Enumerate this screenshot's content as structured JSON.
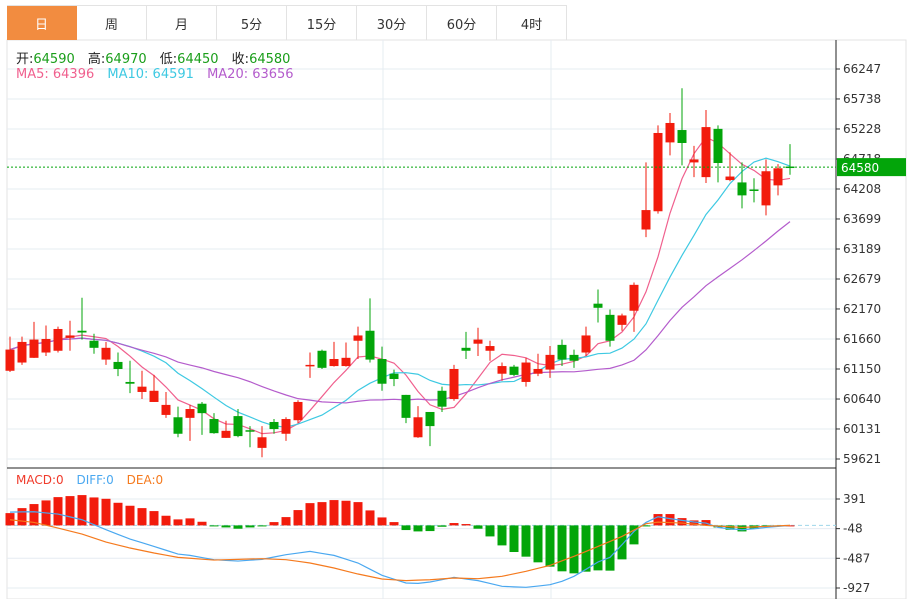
{
  "tabs": [
    {
      "label": "日",
      "active": true
    },
    {
      "label": "周"
    },
    {
      "label": "月"
    },
    {
      "label": "5分"
    },
    {
      "label": "15分"
    },
    {
      "label": "30分"
    },
    {
      "label": "60分"
    },
    {
      "label": "4时"
    }
  ],
  "ohlc_info": {
    "open_label": "开:",
    "open": "64590",
    "high_label": "高:",
    "high": "64970",
    "low_label": "低:",
    "low": "64450",
    "close_label": "收:",
    "close": "64580"
  },
  "ma_info": {
    "ma5": "MA5: 64396",
    "ma10": "MA10: 64591",
    "ma20": "MA20: 63656"
  },
  "macd_info": {
    "macd": "MACD:0",
    "diff": "DIFF:0",
    "dea": "DEA:0"
  },
  "current_price": "64580",
  "colors": {
    "up": "#f21b0c",
    "down": "#03a50a",
    "ma5": "#f0608e",
    "ma10": "#3ec9e2",
    "ma20": "#b45ccc",
    "diff": "#4aa8f0",
    "dea": "#f57a1e",
    "tab_active": "#f28c40"
  },
  "chart_data": {
    "type": "candlestick",
    "price_ticks": [
      66247,
      65738,
      65228,
      64718,
      64208,
      63699,
      63189,
      62679,
      62170,
      61660,
      61150,
      60640,
      60131,
      59621
    ],
    "macd_ticks": [
      391,
      -48,
      -487,
      -927
    ],
    "ohlc": [
      [
        61120,
        61700,
        61100,
        61480
      ],
      [
        61260,
        61700,
        61220,
        61610
      ],
      [
        61340,
        61950,
        61340,
        61650
      ],
      [
        61430,
        61890,
        61370,
        61660
      ],
      [
        61460,
        61870,
        61430,
        61830
      ],
      [
        61680,
        61970,
        61460,
        61720
      ],
      [
        61800,
        62360,
        61650,
        61770
      ],
      [
        61630,
        61750,
        61410,
        61510
      ],
      [
        61310,
        61610,
        61220,
        61510
      ],
      [
        61270,
        61430,
        61030,
        61150
      ],
      [
        60930,
        61290,
        60740,
        60900
      ],
      [
        60760,
        61120,
        60640,
        60850
      ],
      [
        60590,
        61050,
        60590,
        60780
      ],
      [
        60370,
        60760,
        60320,
        60540
      ],
      [
        60330,
        60510,
        59990,
        60050
      ],
      [
        60320,
        60540,
        59930,
        60470
      ],
      [
        60560,
        60590,
        60030,
        60400
      ],
      [
        60300,
        60400,
        60050,
        60060
      ],
      [
        59980,
        60270,
        59980,
        60100
      ],
      [
        60350,
        60470,
        59990,
        60010
      ],
      [
        60110,
        60180,
        59820,
        60100
      ],
      [
        59810,
        60180,
        59650,
        59990
      ],
      [
        60250,
        60300,
        60050,
        60130
      ],
      [
        60050,
        60330,
        59930,
        60300
      ],
      [
        60280,
        60620,
        60230,
        60590
      ],
      [
        61200,
        61430,
        61000,
        61220
      ],
      [
        61460,
        61480,
        61150,
        61170
      ],
      [
        61200,
        61610,
        61190,
        61320
      ],
      [
        61200,
        61600,
        61190,
        61340
      ],
      [
        61630,
        61870,
        61320,
        61720
      ],
      [
        61800,
        62350,
        61260,
        61310
      ],
      [
        61320,
        61530,
        60780,
        60900
      ],
      [
        61070,
        61140,
        60860,
        60980
      ],
      [
        60710,
        60710,
        60230,
        60320
      ],
      [
        59990,
        60520,
        59980,
        60330
      ],
      [
        60420,
        60420,
        59840,
        60180
      ],
      [
        60780,
        60850,
        60420,
        60510
      ],
      [
        60640,
        61220,
        60610,
        61150
      ],
      [
        61510,
        61780,
        61320,
        61460
      ],
      [
        61580,
        61850,
        61370,
        61650
      ],
      [
        61460,
        61630,
        61290,
        61540
      ],
      [
        61070,
        61260,
        60950,
        61200
      ],
      [
        61190,
        61220,
        61030,
        61050
      ],
      [
        60930,
        61340,
        60850,
        61260
      ],
      [
        61070,
        61410,
        61030,
        61150
      ],
      [
        61140,
        61540,
        61000,
        61390
      ],
      [
        61560,
        61650,
        61200,
        61310
      ],
      [
        61390,
        61480,
        61170,
        61290
      ],
      [
        61430,
        61870,
        61370,
        61720
      ],
      [
        62260,
        62500,
        61940,
        62190
      ],
      [
        62070,
        62160,
        61530,
        61630
      ],
      [
        61900,
        62090,
        61800,
        62060
      ],
      [
        62140,
        62620,
        61780,
        62580
      ],
      [
        63520,
        64660,
        63390,
        63850
      ],
      [
        63830,
        65290,
        63790,
        65160
      ],
      [
        65000,
        65500,
        64780,
        65330
      ],
      [
        65210,
        65920,
        64610,
        64990
      ],
      [
        64660,
        64940,
        64410,
        64710
      ],
      [
        64410,
        65550,
        64310,
        65260
      ],
      [
        65230,
        65290,
        64320,
        64650
      ],
      [
        64360,
        64830,
        64340,
        64420
      ],
      [
        64320,
        64660,
        63880,
        64100
      ],
      [
        64200,
        64390,
        63980,
        64190
      ],
      [
        63930,
        64710,
        63760,
        64510
      ],
      [
        64270,
        64630,
        64100,
        64560
      ],
      [
        64590,
        64970,
        64450,
        64580
      ]
    ],
    "macd": [
      182,
      256,
      316,
      370,
      419,
      434,
      449,
      414,
      394,
      335,
      291,
      256,
      212,
      143,
      89,
      104,
      54,
      -10,
      -30,
      -49,
      -30,
      -15,
      49,
      123,
      227,
      330,
      345,
      375,
      365,
      345,
      222,
      118,
      49,
      -69,
      -89,
      -84,
      -20,
      35,
      20,
      -49,
      -163,
      -296,
      -394,
      -463,
      -547,
      -611,
      -680,
      -710,
      -685,
      -666,
      -670,
      -503,
      -281,
      -5,
      168,
      168,
      108,
      74,
      79,
      -30,
      -64,
      -89,
      -54,
      -10,
      -5,
      0
    ],
    "diff": [
      197,
      200,
      202,
      185,
      168,
      126,
      84,
      10,
      -64,
      -133,
      -202,
      -256,
      -311,
      -368,
      -424,
      -444,
      -476,
      -508,
      -518,
      -528,
      -515,
      -503,
      -468,
      -434,
      -410,
      -385,
      -415,
      -444,
      -500,
      -557,
      -648,
      -739,
      -796,
      -853,
      -858,
      -838,
      -804,
      -769,
      -794,
      -818,
      -860,
      -902,
      -910,
      -917,
      -898,
      -878,
      -828,
      -754,
      -650,
      -542,
      -473,
      -286,
      -89,
      44,
      128,
      100,
      74,
      50,
      35,
      -30,
      -50,
      -64,
      -50,
      -30,
      -15,
      0
    ],
    "dea": [
      84,
      64,
      44,
      3,
      -39,
      -84,
      -128,
      -188,
      -247,
      -291,
      -335,
      -372,
      -409,
      -441,
      -473,
      -486,
      -500,
      -513,
      -508,
      -503,
      -498,
      -493,
      -500,
      -508,
      -532,
      -557,
      -594,
      -631,
      -676,
      -720,
      -757,
      -794,
      -806,
      -818,
      -810,
      -805,
      -792,
      -779,
      -784,
      -789,
      -772,
      -754,
      -717,
      -680,
      -636,
      -592,
      -525,
      -458,
      -385,
      -311,
      -237,
      -163,
      -69,
      25,
      49,
      42,
      35,
      18,
      0,
      -10,
      -20,
      -30,
      -22,
      -15,
      -7,
      0
    ],
    "ma_periods": [
      5,
      10,
      20
    ],
    "grid": true
  }
}
